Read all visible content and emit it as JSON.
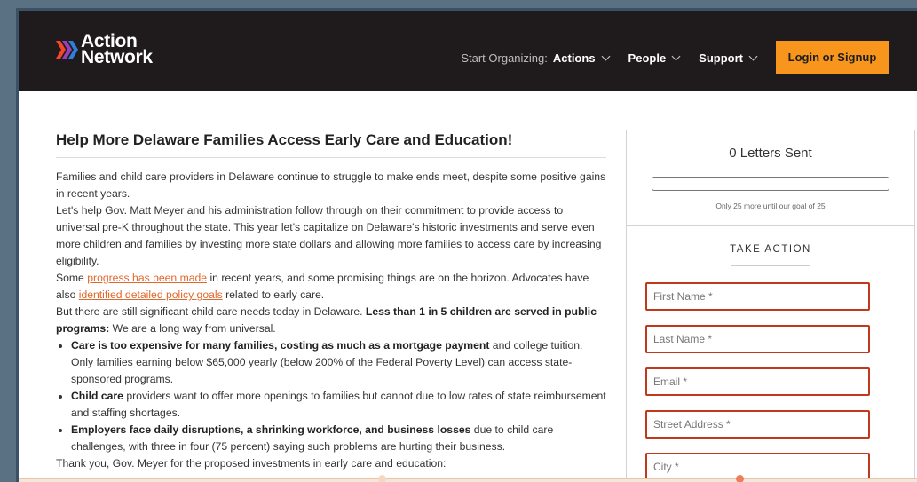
{
  "header": {
    "logo_line1": "Action",
    "logo_line2": "Network",
    "nav_lead": "Start Organizing:",
    "nav_items": [
      {
        "label": "Actions"
      },
      {
        "label": "People"
      },
      {
        "label": "Support"
      }
    ],
    "login_label": "Login or Signup"
  },
  "article": {
    "title": "Help More Delaware Families Access Early Care and Education!",
    "p1": "Families and child care providers in Delaware continue to struggle to make ends meet, despite some positive gains in recent years.",
    "p2": "Let's help Gov. Matt Meyer and his administration follow through on their commitment to provide access to universal pre-K throughout the state. This year let's capitalize on Delaware's historic investments and serve even more children and families by investing more state dollars and allowing more families to access care by increasing eligibility.",
    "p3_start": "Some ",
    "p3_link": "progress has been made",
    "p3_mid": " in recent years, and some promising things are on the horizon. Advocates have also ",
    "p3_link2": "identified detailed policy goals",
    "p3_end": " related to early care.",
    "p4_start": "But there are still significant child care needs today in Delaware. ",
    "p4_bold": "Less than 1 in 5 children are served in public programs:",
    "p4_end": " We are a long way from universal.",
    "bullets": [
      {
        "bold": "Care is too expensive for many families, costing as much as a mortgage payment",
        "text": " and college tuition. Only families earning below $65,000 yearly (below 200% of the Federal Poverty Level) can access state-sponsored programs."
      },
      {
        "bold": "Child care",
        "text": " providers want to offer more openings to families but cannot due to low rates of state reimbursement and staffing shortages."
      },
      {
        "bold": "Employers face daily disruptions, a shrinking workforce, and business losses",
        "text": " due to child care challenges, with three in four (75 percent) saying such problems are hurting their business."
      }
    ],
    "p5": "Thank you, Gov. Meyer for the proposed investments in early care and education:"
  },
  "sidebar": {
    "counter": "0 Letters Sent",
    "progress_fraction": 0,
    "goal_text": "Only 25 more until our goal of 25",
    "take_action": "TAKE ACTION",
    "fields": {
      "first_name": "First Name *",
      "last_name": "Last Name *",
      "email": "Email *",
      "street": "Street Address *",
      "city": "City *"
    }
  },
  "colors": {
    "header_bg": "#1f1a1b",
    "accent_orange": "#f7951d",
    "link": "#e2672b",
    "field_border": "#c0391b"
  }
}
